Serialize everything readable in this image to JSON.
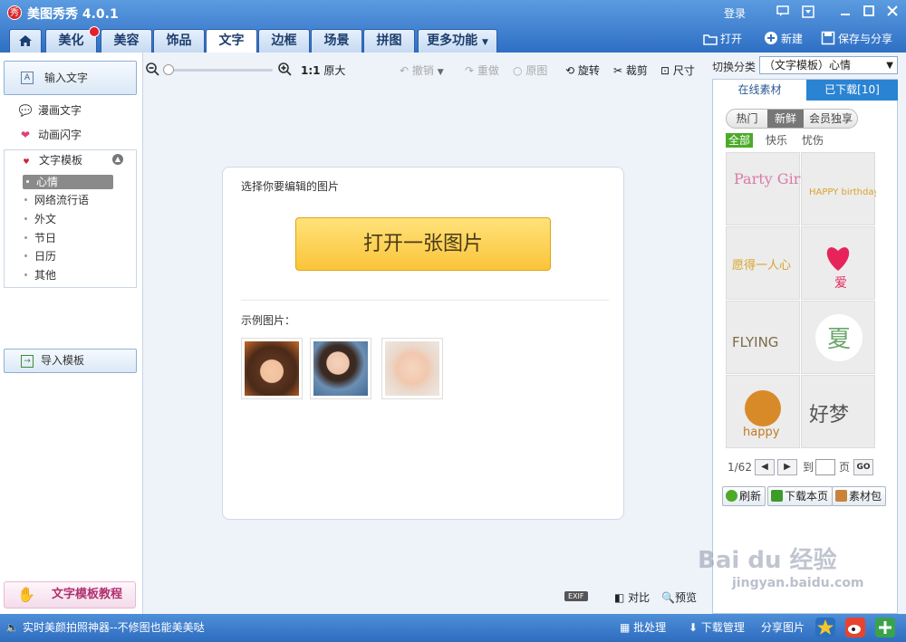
{
  "app": {
    "title": "美图秀秀 4.0.1",
    "logo_text": "秀"
  },
  "titlebar": {
    "login": "登录"
  },
  "tabs": [
    {
      "label": "美化"
    },
    {
      "label": "美容"
    },
    {
      "label": "饰品"
    },
    {
      "label": "文字"
    },
    {
      "label": "边框"
    },
    {
      "label": "场景"
    },
    {
      "label": "拼图"
    },
    {
      "label": "更多功能"
    }
  ],
  "top_actions": {
    "open": "打开",
    "new": "新建",
    "save_share": "保存与分享"
  },
  "left": {
    "input_text": "输入文字",
    "comic_text": "漫画文字",
    "anim_text": "动画闪字",
    "template_header": "文字模板",
    "template_icon_text": "I ♥ YOU",
    "subitems": [
      "心情",
      "网络流行语",
      "外文",
      "节日",
      "日历",
      "其他"
    ],
    "import_template": "导入模板",
    "tutorial": "文字模板教程"
  },
  "toolbar": {
    "original_size_ratio": "1:1",
    "original_size": "原大",
    "undo": "撤销",
    "redo": "重做",
    "original": "原图",
    "rotate": "旋转",
    "crop": "裁剪",
    "size": "尺寸"
  },
  "card": {
    "title": "选择你要编辑的图片",
    "open_button": "打开一张图片",
    "sample_label": "示例图片："
  },
  "bottom": {
    "exif": "EXIF",
    "compare": "对比",
    "preview": "预览"
  },
  "right": {
    "switch_label": "切换分类",
    "switch_value": "（文字模板）心情",
    "tab_online": "在线素材",
    "tab_downloaded": "已下载[10]",
    "seg": [
      "热门",
      "新鲜",
      "会员独享"
    ],
    "filters": [
      "全部",
      "快乐",
      "忧伤"
    ],
    "pager": {
      "current": "1/62",
      "to": "到",
      "page": "页",
      "go": "GO"
    },
    "actions": {
      "refresh": "刷新",
      "download_page": "下载本页",
      "pack": "素材包"
    },
    "stickers": [
      "Party Girl",
      "HAPPY birthday",
      "愿得一人心",
      "爱",
      "FLYING",
      "夏",
      "happy",
      "好梦"
    ]
  },
  "status": {
    "tip": "实时美颜拍照神器--不修图也能美美哒",
    "batch": "批处理",
    "download_mgr": "下载管理",
    "share": "分享图片"
  },
  "watermark": {
    "line1": "Bai du 经验",
    "line2": "jingyan.baidu.com"
  },
  "colors": {
    "accent": "#2f6fc4",
    "open_button": "#fbc43a",
    "active_filter": "#4caa28",
    "badge": "#e4202a"
  }
}
